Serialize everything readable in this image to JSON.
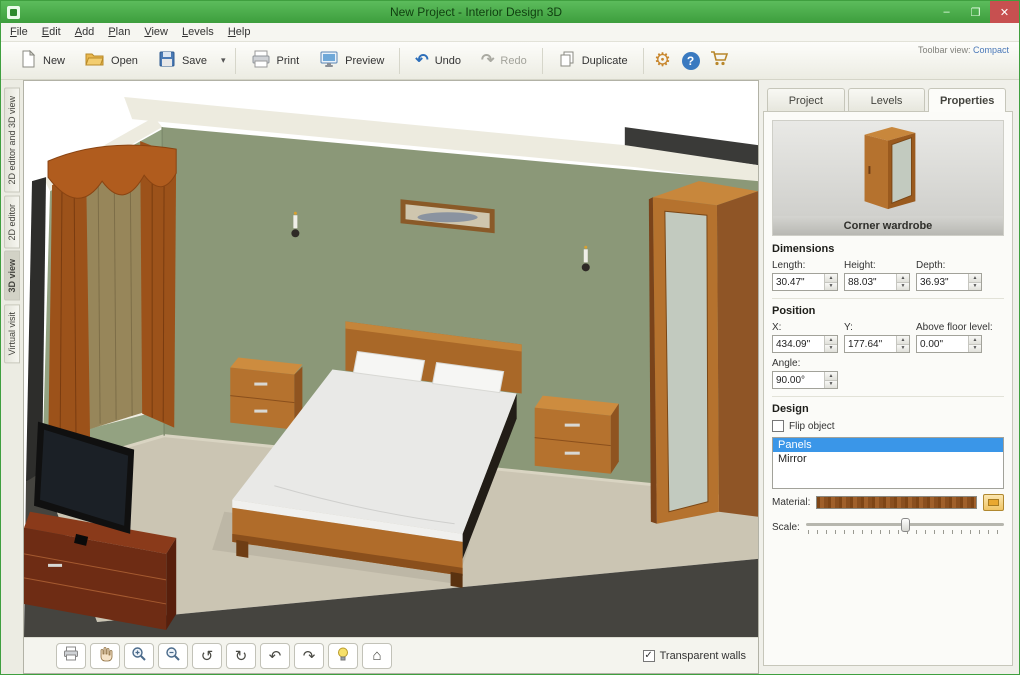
{
  "window": {
    "title": "New Project - Interior Design 3D",
    "controls": {
      "minimize": "–",
      "maximize": "❐",
      "close": "✕"
    }
  },
  "menu": {
    "items": [
      "File",
      "Edit",
      "Add",
      "Plan",
      "View",
      "Levels",
      "Help"
    ]
  },
  "toolbar": {
    "new": "New",
    "open": "Open",
    "save": "Save",
    "print": "Print",
    "preview": "Preview",
    "undo": "Undo",
    "redo": "Redo",
    "duplicate": "Duplicate",
    "view_label": "Toolbar view:",
    "view_value": "Compact"
  },
  "icons": {
    "save_dropdown": "▾",
    "gear": "⚙",
    "help": "?",
    "undo": "↶",
    "redo": "↷",
    "check": "✓"
  },
  "left_tabs": {
    "items": [
      "2D editor and 3D view",
      "2D editor",
      "3D view",
      "Virtual visit"
    ]
  },
  "viewport": {
    "transparent_walls": "Transparent walls",
    "nav": {
      "rotate_left": "↺",
      "rotate_right": "↻",
      "orbit_left": "↶",
      "orbit_right": "↷",
      "home": "⌂"
    }
  },
  "panel": {
    "tabs": [
      "Project",
      "Levels",
      "Properties"
    ],
    "object_caption": "Corner wardrobe",
    "dimensions": {
      "title": "Dimensions",
      "length_label": "Length:",
      "length": "30.47\"",
      "height_label": "Height:",
      "height": "88.03\"",
      "depth_label": "Depth:",
      "depth": "36.93\""
    },
    "position": {
      "title": "Position",
      "x_label": "X:",
      "x": "434.09\"",
      "y_label": "Y:",
      "y": "177.64\"",
      "afl_label": "Above floor level:",
      "afl": "0.00\"",
      "angle_label": "Angle:",
      "angle": "90.00°"
    },
    "design": {
      "title": "Design",
      "flip": "Flip object",
      "items": [
        "Panels",
        "Mirror"
      ],
      "material_label": "Material:",
      "scale_label": "Scale:"
    }
  }
}
